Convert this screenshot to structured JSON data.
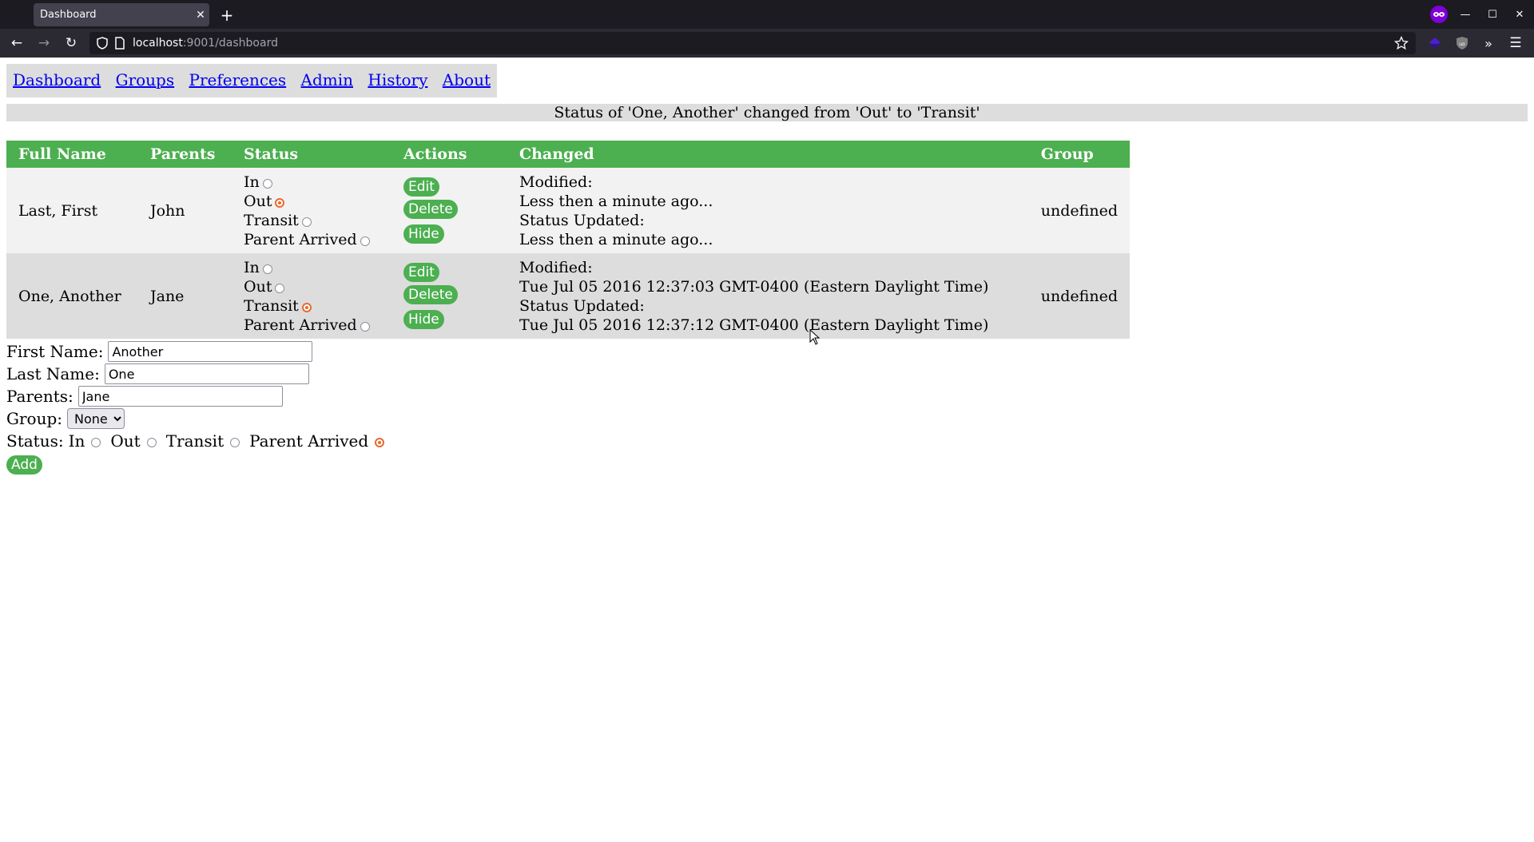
{
  "browser": {
    "tab_title": "Dashboard",
    "url_host": "localhost",
    "url_path": ":9001/dashboard"
  },
  "nav": {
    "items": [
      {
        "label": "Dashboard"
      },
      {
        "label": "Groups"
      },
      {
        "label": "Preferences"
      },
      {
        "label": "Admin"
      },
      {
        "label": "History"
      },
      {
        "label": "About"
      }
    ]
  },
  "banner": {
    "message": "Status of 'One, Another' changed from 'Out' to 'Transit'"
  },
  "table": {
    "headers": [
      "Full Name",
      "Parents",
      "Status",
      "Actions",
      "Changed",
      "Group"
    ],
    "status_options": [
      "In",
      "Out",
      "Transit",
      "Parent Arrived"
    ],
    "action_labels": {
      "edit": "Edit",
      "delete": "Delete",
      "hide": "Hide"
    },
    "rows": [
      {
        "full_name": "Last, First",
        "parents": "John",
        "status": "Out",
        "modified_label": "Modified:",
        "modified": "Less then a minute ago...",
        "status_updated_label": "Status Updated:",
        "status_updated": "Less then a minute ago...",
        "group": "undefined"
      },
      {
        "full_name": "One, Another",
        "parents": "Jane",
        "status": "Transit",
        "modified_label": "Modified:",
        "modified": "Tue Jul 05 2016 12:37:03 GMT-0400 (Eastern Daylight Time)",
        "status_updated_label": "Status Updated:",
        "status_updated": "Tue Jul 05 2016 12:37:12 GMT-0400 (Eastern Daylight Time)",
        "group": "undefined"
      }
    ]
  },
  "form": {
    "first_name_label": "First Name:",
    "first_name_value": "Another",
    "last_name_label": "Last Name:",
    "last_name_value": "One",
    "parents_label": "Parents:",
    "parents_value": "Jane",
    "group_label": "Group:",
    "group_selected": "None",
    "status_label": "Status:",
    "status_options": [
      "In",
      "Out",
      "Transit",
      "Parent Arrived"
    ],
    "status_selected": "Parent Arrived",
    "add_label": "Add"
  },
  "colors": {
    "header_green": "#4caf50",
    "radio_checked": "#e66b2e",
    "row_even": "#f2f2f2",
    "row_odd": "#dddddd"
  }
}
